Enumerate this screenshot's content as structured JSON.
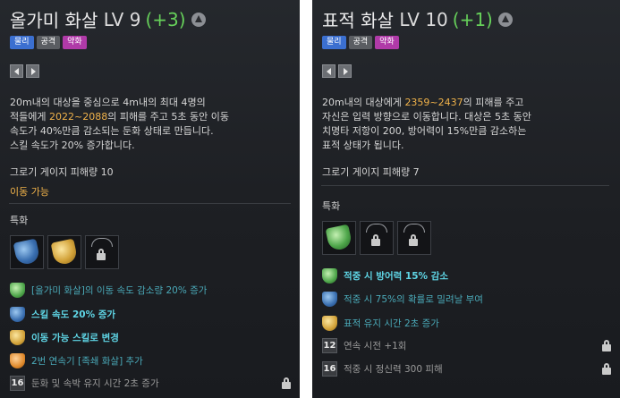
{
  "left": {
    "name": "올가미 화살",
    "level": "LV 9",
    "bonus": "(+3)",
    "tags": [
      {
        "label": "물리",
        "color": "#3b6fd0"
      },
      {
        "label": "공격",
        "color": "#5a5d62"
      },
      {
        "label": "약화",
        "color": "#b03aa8"
      }
    ],
    "desc": [
      [
        "20m내의 대상을 중심으로 4m내의 최대 4명의"
      ],
      [
        "적들에게 ",
        {
          "hl": "2022~2088"
        },
        "의 피해를 주고 5초 동안 이동"
      ],
      [
        "속도가 40%만큼 감소되는 둔화 상태로 만듭니다."
      ],
      [
        "스킬 속도가 20% 증가합니다."
      ]
    ],
    "gauge_text": "그로기 게이지 피해량 10",
    "movable_text": "이동 가능",
    "spec_label": "특화",
    "slots": [
      "blue-gem",
      "gold-gem",
      "lock"
    ],
    "tripods": [
      {
        "icon": "green",
        "text": "[올가미 화살]의 이동 속도 감소량 20% 증가",
        "style": "dim",
        "locked": false
      },
      {
        "icon": "blue",
        "text": "스킬 속도 20% 증가",
        "style": "active",
        "locked": false
      },
      {
        "icon": "gold",
        "text": "이동 가능 스킬로 변경",
        "style": "active",
        "locked": false
      },
      {
        "icon": "orange",
        "text": "2번 연속기 [족쇄 화살] 추가",
        "style": "dim",
        "locked": false
      },
      {
        "icon": "16",
        "text": "둔화 및 속박 유지 시간 2초 증가",
        "style": "gray",
        "locked": true
      }
    ]
  },
  "right": {
    "name": "표적 화살",
    "level": "LV 10",
    "bonus": "(+1)",
    "tags": [
      {
        "label": "물리",
        "color": "#3b6fd0"
      },
      {
        "label": "공격",
        "color": "#5a5d62"
      },
      {
        "label": "약화",
        "color": "#b03aa8"
      }
    ],
    "desc": [
      [
        "20m내의 대상에게 ",
        {
          "hl": "2359~2437"
        },
        "의 피해를 주고"
      ],
      [
        "자신은 입력 방향으로 이동합니다. 대상은 5초 동안"
      ],
      [
        "치명타 저항이 200, 방어력이 15%만큼 감소하는"
      ],
      [
        "표적 상태가 됩니다."
      ]
    ],
    "gauge_text": "그로기 게이지 피해량 7",
    "spec_label": "특화",
    "slots": [
      "green-gem",
      "lock",
      "lock"
    ],
    "tripods": [
      {
        "icon": "green",
        "text": "적중 시 방어력 15% 감소",
        "style": "active",
        "locked": false
      },
      {
        "icon": "blue",
        "text": "적중 시 75%의 확률로 밀려날 부여",
        "style": "dim",
        "locked": false
      },
      {
        "icon": "gold",
        "text": "표적 유지 시간 2초 증가",
        "style": "dim",
        "locked": false
      },
      {
        "icon": "12",
        "text": "연속 시전 +1회",
        "style": "gray",
        "locked": true
      },
      {
        "icon": "16",
        "text": "적중 시 정신력 300 피해",
        "style": "gray",
        "locked": true
      }
    ]
  }
}
